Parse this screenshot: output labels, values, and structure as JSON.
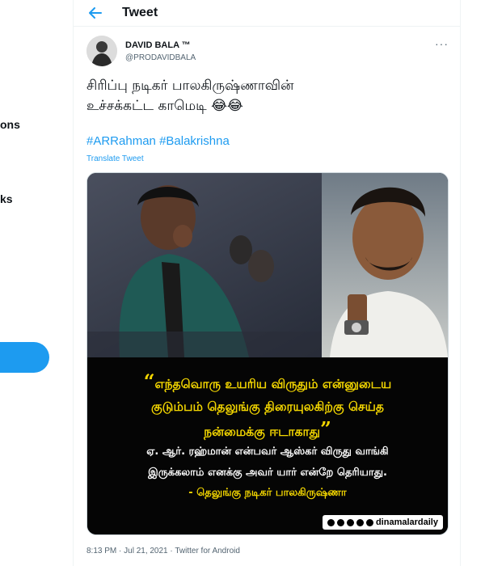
{
  "left_nav": {
    "item_a": "ons",
    "item_b": "ks"
  },
  "header": {
    "title": "Tweet"
  },
  "tweet": {
    "author_name": "DAVID BALA ™",
    "author_handle": "@PRODAVIDBALA",
    "text_line1": "சிரிப்பு நடிகர் பாலகிருஷ்ணாவின்",
    "text_line2": "உச்சக்கட்ட காமெடி 😂😂",
    "hashtags": [
      "#ARRahman",
      "#Balakrishna"
    ],
    "translate_label": "Translate Tweet",
    "timestamp": "8:13 PM · Jul 21, 2021 · Twitter for Android"
  },
  "media": {
    "quote_open": "“",
    "quote_line1": "எந்தவொரு உயரிய விருதும் என்னுடைய",
    "quote_line2": "குடும்பம் தெலுங்கு திரையுலகிற்கு செய்த",
    "quote_line3": "நன்மைக்கு ஈடாகாது",
    "quote_close": "”",
    "subtext_line1": "ஏ. ஆர். ரஹ்மான் என்பவர் ஆஸ்கர் விருது வாங்கி",
    "subtext_line2": "இருக்கலாம் எனக்கு அவர் யார் என்றே தெரியாது.",
    "attribution": "- தெலுங்கு நடிகர் பாலகிருஷ்ணா",
    "brand": "dinamalardaily"
  },
  "colors": {
    "accent": "#1d9bf0",
    "quote_yellow": "#f2d500"
  }
}
